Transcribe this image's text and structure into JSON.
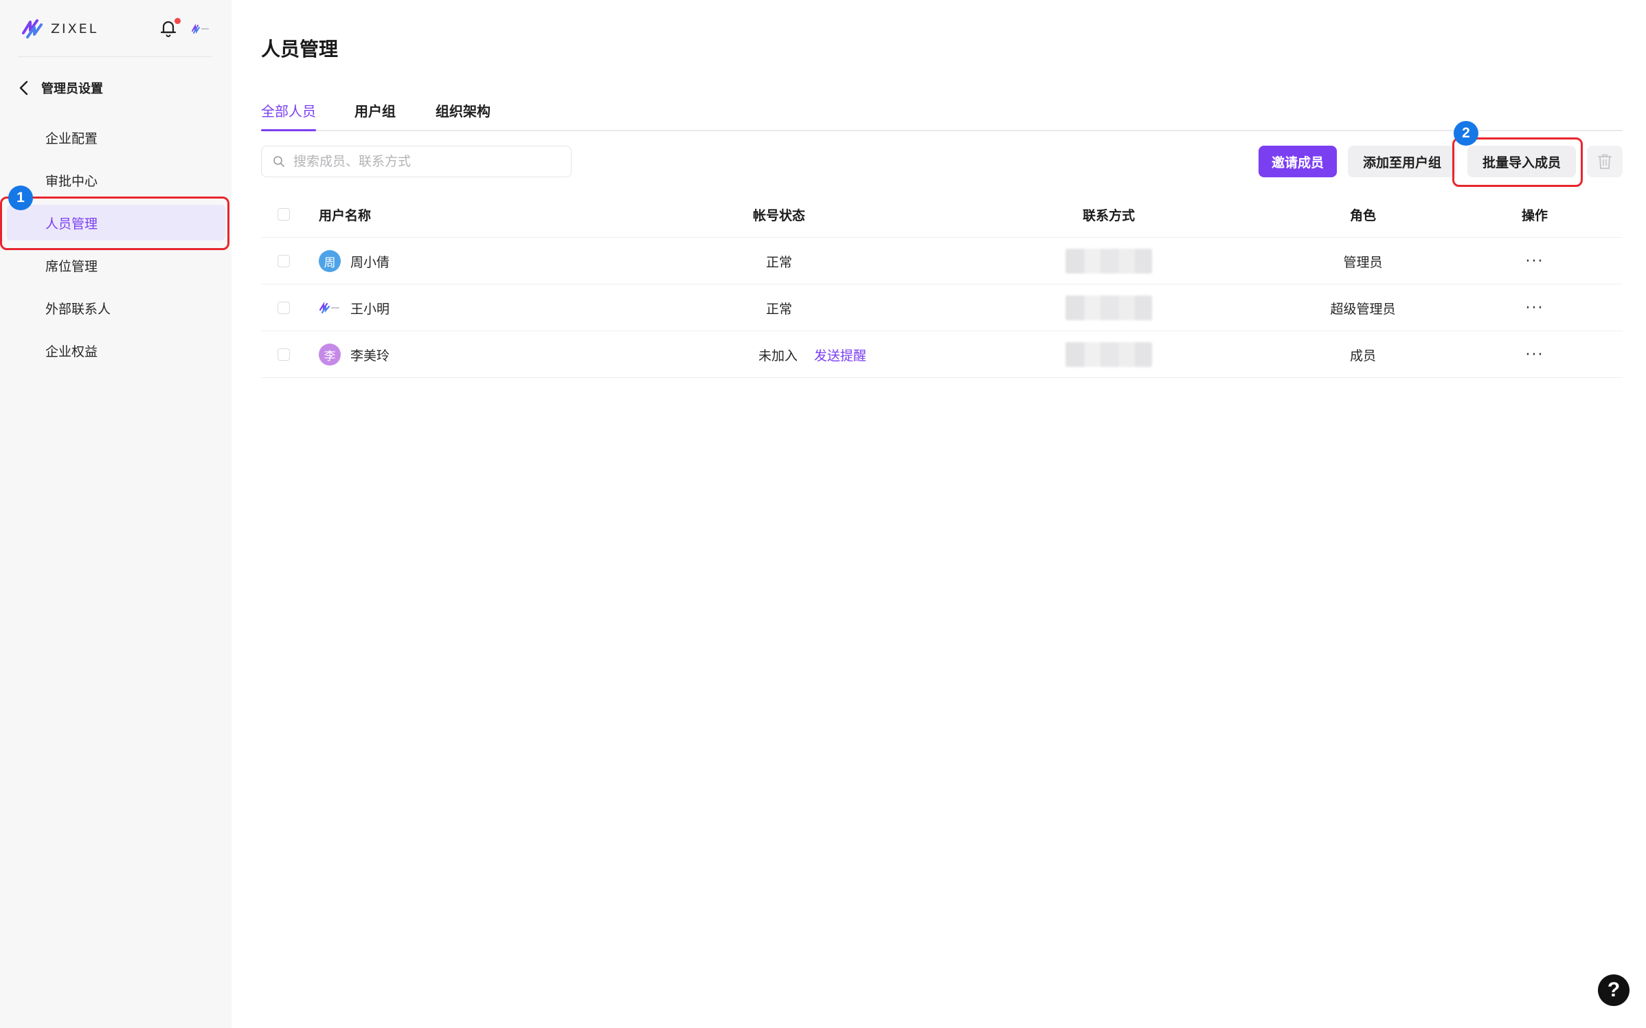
{
  "brand": {
    "name": "ZIXEL"
  },
  "sidebar": {
    "back_label": "管理员设置",
    "items": [
      {
        "label": "企业配置",
        "active": false
      },
      {
        "label": "审批中心",
        "active": false
      },
      {
        "label": "人员管理",
        "active": true
      },
      {
        "label": "席位管理",
        "active": false
      },
      {
        "label": "外部联系人",
        "active": false
      },
      {
        "label": "企业权益",
        "active": false
      }
    ]
  },
  "main": {
    "title": "人员管理",
    "tabs": [
      {
        "label": "全部人员",
        "active": true
      },
      {
        "label": "用户组",
        "active": false
      },
      {
        "label": "组织架构",
        "active": false
      }
    ],
    "search": {
      "placeholder": "搜索成员、联系方式",
      "value": ""
    },
    "toolbar": {
      "invite_label": "邀请成员",
      "add_to_group_label": "添加至用户组",
      "bulk_import_label": "批量导入成员"
    },
    "table": {
      "columns": [
        "用户名称",
        "帐号状态",
        "联系方式",
        "角色",
        "操作"
      ],
      "rows": [
        {
          "avatar_char": "周",
          "avatar_color": "#4ea3e8",
          "name": "周小倩",
          "status": "正常",
          "action_link": "",
          "role": "管理员",
          "more": "···"
        },
        {
          "avatar_char": "",
          "avatar_color": "",
          "name": "王小明",
          "status": "正常",
          "action_link": "",
          "role": "超级管理员",
          "more": "···"
        },
        {
          "avatar_char": "李",
          "avatar_color": "#c58ae8",
          "name": "李美玲",
          "status": "未加入",
          "action_link": "发送提醒",
          "role": "成员",
          "more": "···"
        }
      ]
    }
  },
  "annotations": {
    "badge_1": "1",
    "badge_2": "2",
    "highlight_color": "#e8262d",
    "badge_color": "#1677e6"
  },
  "help": {
    "label": "?"
  },
  "colors": {
    "accent": "#7b3ff2",
    "sidebar_bg": "#f7f7f8",
    "notification_dot": "#f5484a"
  }
}
